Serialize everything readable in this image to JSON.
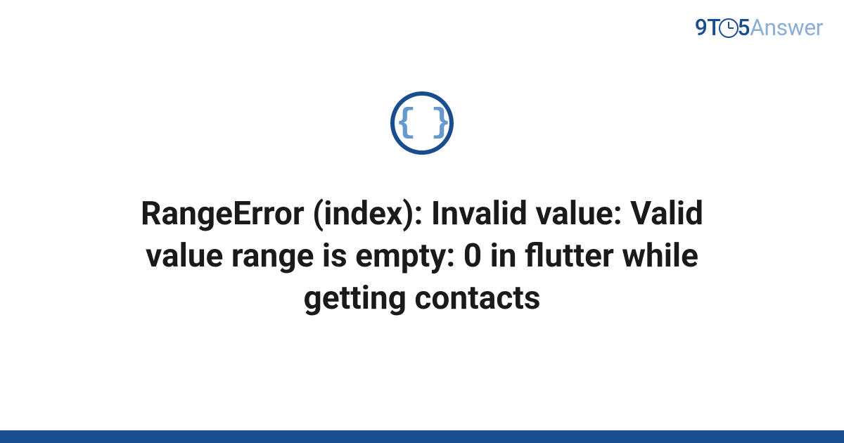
{
  "logo": {
    "part1": "9T",
    "part2": "5",
    "part3": "Answer"
  },
  "icon": {
    "name": "code-braces-icon",
    "glyph": "{ }"
  },
  "title": "RangeError (index): Invalid value: Valid value range is empty: 0 in flutter while getting contacts",
  "colors": {
    "primary": "#1a4d8f",
    "accent": "#6699cc",
    "logoLight": "#8aaed4"
  }
}
